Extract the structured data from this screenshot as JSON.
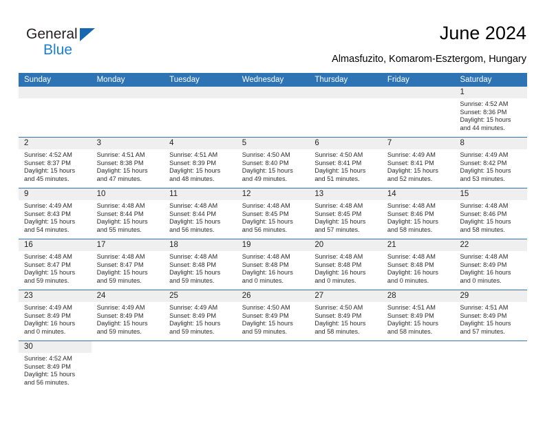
{
  "brand": {
    "name_top": "General",
    "name_bottom": "Blue",
    "accent_color": "#1b7fd0",
    "triangle_color": "#1567b0"
  },
  "header": {
    "title": "June 2024",
    "subtitle": "Almasfuzito, Komarom-Esztergom, Hungary"
  },
  "calendar": {
    "header_bg": "#2e74b5",
    "daynum_bg": "#efefef",
    "columns": [
      "Sunday",
      "Monday",
      "Tuesday",
      "Wednesday",
      "Thursday",
      "Friday",
      "Saturday"
    ],
    "weeks": [
      [
        {
          "day": "",
          "empty": true
        },
        {
          "day": "",
          "empty": true
        },
        {
          "day": "",
          "empty": true
        },
        {
          "day": "",
          "empty": true
        },
        {
          "day": "",
          "empty": true
        },
        {
          "day": "",
          "empty": true
        },
        {
          "day": "1",
          "sunrise": "Sunrise: 4:52 AM",
          "sunset": "Sunset: 8:36 PM",
          "daylight1": "Daylight: 15 hours",
          "daylight2": "and 44 minutes."
        }
      ],
      [
        {
          "day": "2",
          "sunrise": "Sunrise: 4:52 AM",
          "sunset": "Sunset: 8:37 PM",
          "daylight1": "Daylight: 15 hours",
          "daylight2": "and 45 minutes."
        },
        {
          "day": "3",
          "sunrise": "Sunrise: 4:51 AM",
          "sunset": "Sunset: 8:38 PM",
          "daylight1": "Daylight: 15 hours",
          "daylight2": "and 47 minutes."
        },
        {
          "day": "4",
          "sunrise": "Sunrise: 4:51 AM",
          "sunset": "Sunset: 8:39 PM",
          "daylight1": "Daylight: 15 hours",
          "daylight2": "and 48 minutes."
        },
        {
          "day": "5",
          "sunrise": "Sunrise: 4:50 AM",
          "sunset": "Sunset: 8:40 PM",
          "daylight1": "Daylight: 15 hours",
          "daylight2": "and 49 minutes."
        },
        {
          "day": "6",
          "sunrise": "Sunrise: 4:50 AM",
          "sunset": "Sunset: 8:41 PM",
          "daylight1": "Daylight: 15 hours",
          "daylight2": "and 51 minutes."
        },
        {
          "day": "7",
          "sunrise": "Sunrise: 4:49 AM",
          "sunset": "Sunset: 8:41 PM",
          "daylight1": "Daylight: 15 hours",
          "daylight2": "and 52 minutes."
        },
        {
          "day": "8",
          "sunrise": "Sunrise: 4:49 AM",
          "sunset": "Sunset: 8:42 PM",
          "daylight1": "Daylight: 15 hours",
          "daylight2": "and 53 minutes."
        }
      ],
      [
        {
          "day": "9",
          "sunrise": "Sunrise: 4:49 AM",
          "sunset": "Sunset: 8:43 PM",
          "daylight1": "Daylight: 15 hours",
          "daylight2": "and 54 minutes."
        },
        {
          "day": "10",
          "sunrise": "Sunrise: 4:48 AM",
          "sunset": "Sunset: 8:44 PM",
          "daylight1": "Daylight: 15 hours",
          "daylight2": "and 55 minutes."
        },
        {
          "day": "11",
          "sunrise": "Sunrise: 4:48 AM",
          "sunset": "Sunset: 8:44 PM",
          "daylight1": "Daylight: 15 hours",
          "daylight2": "and 56 minutes."
        },
        {
          "day": "12",
          "sunrise": "Sunrise: 4:48 AM",
          "sunset": "Sunset: 8:45 PM",
          "daylight1": "Daylight: 15 hours",
          "daylight2": "and 56 minutes."
        },
        {
          "day": "13",
          "sunrise": "Sunrise: 4:48 AM",
          "sunset": "Sunset: 8:45 PM",
          "daylight1": "Daylight: 15 hours",
          "daylight2": "and 57 minutes."
        },
        {
          "day": "14",
          "sunrise": "Sunrise: 4:48 AM",
          "sunset": "Sunset: 8:46 PM",
          "daylight1": "Daylight: 15 hours",
          "daylight2": "and 58 minutes."
        },
        {
          "day": "15",
          "sunrise": "Sunrise: 4:48 AM",
          "sunset": "Sunset: 8:46 PM",
          "daylight1": "Daylight: 15 hours",
          "daylight2": "and 58 minutes."
        }
      ],
      [
        {
          "day": "16",
          "sunrise": "Sunrise: 4:48 AM",
          "sunset": "Sunset: 8:47 PM",
          "daylight1": "Daylight: 15 hours",
          "daylight2": "and 59 minutes."
        },
        {
          "day": "17",
          "sunrise": "Sunrise: 4:48 AM",
          "sunset": "Sunset: 8:47 PM",
          "daylight1": "Daylight: 15 hours",
          "daylight2": "and 59 minutes."
        },
        {
          "day": "18",
          "sunrise": "Sunrise: 4:48 AM",
          "sunset": "Sunset: 8:48 PM",
          "daylight1": "Daylight: 15 hours",
          "daylight2": "and 59 minutes."
        },
        {
          "day": "19",
          "sunrise": "Sunrise: 4:48 AM",
          "sunset": "Sunset: 8:48 PM",
          "daylight1": "Daylight: 16 hours",
          "daylight2": "and 0 minutes."
        },
        {
          "day": "20",
          "sunrise": "Sunrise: 4:48 AM",
          "sunset": "Sunset: 8:48 PM",
          "daylight1": "Daylight: 16 hours",
          "daylight2": "and 0 minutes."
        },
        {
          "day": "21",
          "sunrise": "Sunrise: 4:48 AM",
          "sunset": "Sunset: 8:48 PM",
          "daylight1": "Daylight: 16 hours",
          "daylight2": "and 0 minutes."
        },
        {
          "day": "22",
          "sunrise": "Sunrise: 4:48 AM",
          "sunset": "Sunset: 8:49 PM",
          "daylight1": "Daylight: 16 hours",
          "daylight2": "and 0 minutes."
        }
      ],
      [
        {
          "day": "23",
          "sunrise": "Sunrise: 4:49 AM",
          "sunset": "Sunset: 8:49 PM",
          "daylight1": "Daylight: 16 hours",
          "daylight2": "and 0 minutes."
        },
        {
          "day": "24",
          "sunrise": "Sunrise: 4:49 AM",
          "sunset": "Sunset: 8:49 PM",
          "daylight1": "Daylight: 15 hours",
          "daylight2": "and 59 minutes."
        },
        {
          "day": "25",
          "sunrise": "Sunrise: 4:49 AM",
          "sunset": "Sunset: 8:49 PM",
          "daylight1": "Daylight: 15 hours",
          "daylight2": "and 59 minutes."
        },
        {
          "day": "26",
          "sunrise": "Sunrise: 4:50 AM",
          "sunset": "Sunset: 8:49 PM",
          "daylight1": "Daylight: 15 hours",
          "daylight2": "and 59 minutes."
        },
        {
          "day": "27",
          "sunrise": "Sunrise: 4:50 AM",
          "sunset": "Sunset: 8:49 PM",
          "daylight1": "Daylight: 15 hours",
          "daylight2": "and 58 minutes."
        },
        {
          "day": "28",
          "sunrise": "Sunrise: 4:51 AM",
          "sunset": "Sunset: 8:49 PM",
          "daylight1": "Daylight: 15 hours",
          "daylight2": "and 58 minutes."
        },
        {
          "day": "29",
          "sunrise": "Sunrise: 4:51 AM",
          "sunset": "Sunset: 8:49 PM",
          "daylight1": "Daylight: 15 hours",
          "daylight2": "and 57 minutes."
        }
      ],
      [
        {
          "day": "30",
          "sunrise": "Sunrise: 4:52 AM",
          "sunset": "Sunset: 8:49 PM",
          "daylight1": "Daylight: 15 hours",
          "daylight2": "and 56 minutes."
        },
        {
          "day": "",
          "empty": true,
          "blank": true
        },
        {
          "day": "",
          "empty": true,
          "blank": true
        },
        {
          "day": "",
          "empty": true,
          "blank": true
        },
        {
          "day": "",
          "empty": true,
          "blank": true
        },
        {
          "day": "",
          "empty": true,
          "blank": true
        },
        {
          "day": "",
          "empty": true,
          "blank": true
        }
      ]
    ]
  }
}
